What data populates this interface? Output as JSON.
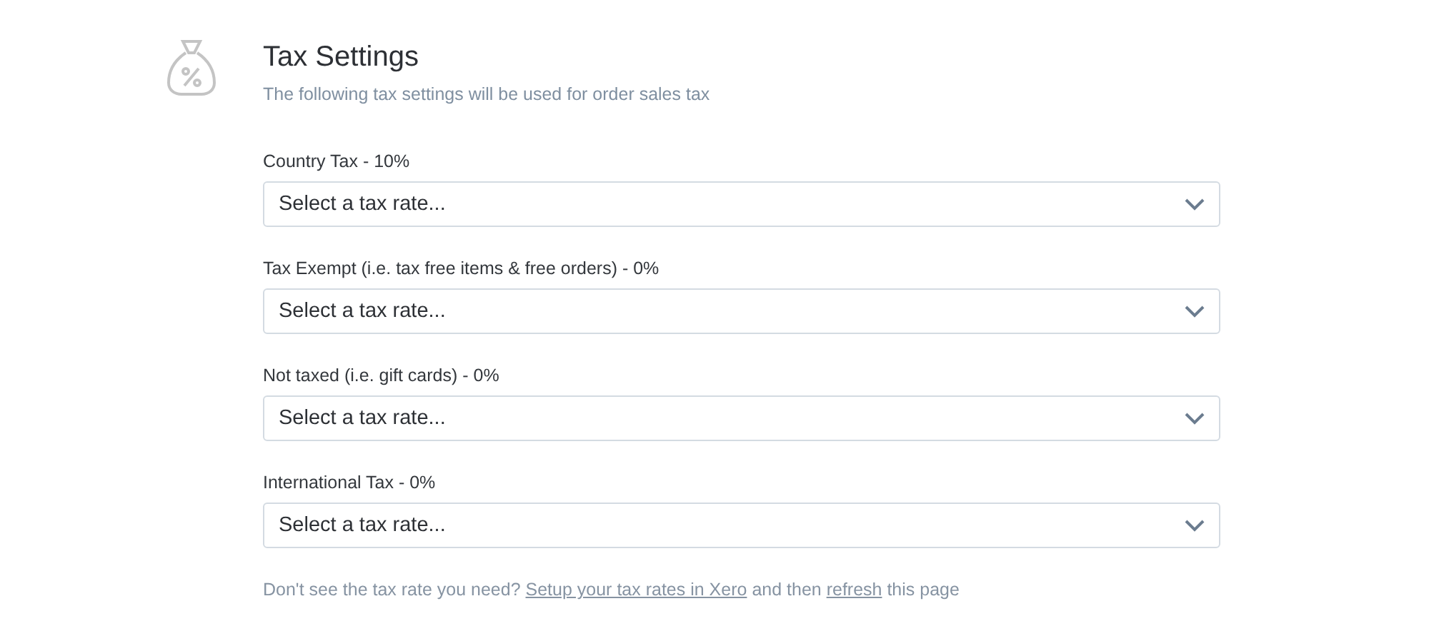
{
  "header": {
    "title": "Tax Settings",
    "subtitle": "The following tax settings will be used for order sales tax"
  },
  "fields": [
    {
      "label": "Country Tax - 10%",
      "placeholder": "Select a tax rate..."
    },
    {
      "label": "Tax Exempt (i.e. tax free items & free orders) - 0%",
      "placeholder": "Select a tax rate..."
    },
    {
      "label": "Not taxed (i.e. gift cards) - 0%",
      "placeholder": "Select a tax rate..."
    },
    {
      "label": "International Tax - 0%",
      "placeholder": "Select a tax rate..."
    }
  ],
  "footer": [
    {
      "kind": "text",
      "text": "Don't see the tax rate you need? "
    },
    {
      "kind": "link",
      "text": "Setup your tax rates in Xero"
    },
    {
      "kind": "text",
      "text": " and then "
    },
    {
      "kind": "link",
      "text": "refresh"
    },
    {
      "kind": "text",
      "text": " this page"
    }
  ]
}
